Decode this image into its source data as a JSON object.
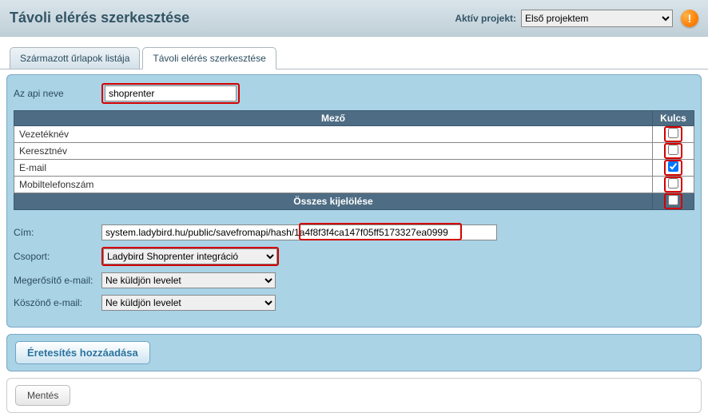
{
  "header": {
    "title": "Távoli elérés szerkesztése",
    "project_label": "Aktív projekt:",
    "project_selected": "Első projektem",
    "alert": "!"
  },
  "tabs": {
    "list_forms": "Származott űrlapok listája",
    "edit_remote": "Távoli elérés szerkesztése"
  },
  "form": {
    "api_name_label": "Az api neve",
    "api_name_value": "shoprenter",
    "fields_table": {
      "col_mezo": "Mező",
      "col_kulcs": "Kulcs",
      "rows": [
        {
          "label": "Vezetéknév",
          "checked": false
        },
        {
          "label": "Keresztnév",
          "checked": false
        },
        {
          "label": "E-mail",
          "checked": true
        },
        {
          "label": "Mobiltelefonszám",
          "checked": false
        }
      ],
      "select_all_label": "Összes kijelölése",
      "select_all_checked": false
    },
    "url_label": "Cím:",
    "url_value": "system.ladybird.hu/public/savefromapi/hash/1a4f8f3f4ca147f05ff5173327ea0999",
    "group_label": "Csoport:",
    "group_value": "Ladybird Shoprenter integráció",
    "confirm_email_label": "Megerősítő e-mail:",
    "confirm_email_value": "Ne küldjön levelet",
    "thankyou_email_label": "Köszönő e-mail:",
    "thankyou_email_value": "Ne küldjön levelet"
  },
  "buttons": {
    "add_notification": "Éretesítés hozzáadása",
    "save": "Mentés"
  }
}
